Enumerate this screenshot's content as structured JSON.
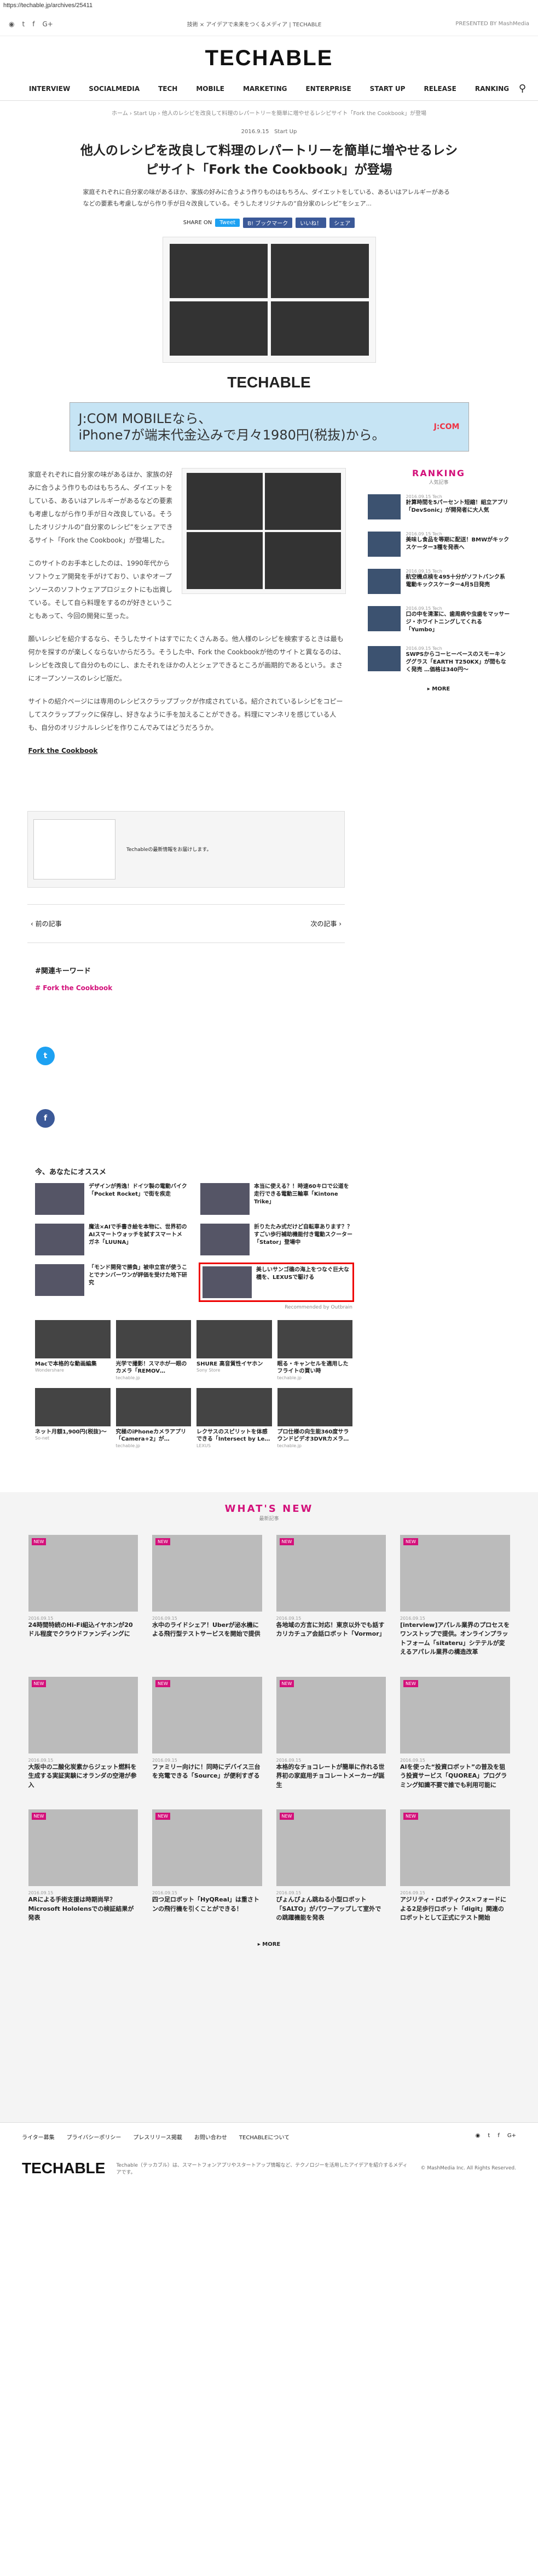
{
  "url": "https://techable.jp/archives/25411",
  "social": [
    "ׄ",
    "f",
    "G+"
  ],
  "topbar": {
    "center": "技術 × アイデアで未来をつくるメディア | TECHABLE",
    "right": "PRESENTED BY MashMedia"
  },
  "logo": "TECHABLE",
  "nav": [
    "INTERVIEW",
    "SOCIALMEDIA",
    "TECH",
    "MOBILE",
    "MARKETING",
    "ENTERPRISE",
    "START UP",
    "RELEASE",
    "RANKING"
  ],
  "breadcrumb": "ホーム › Start Up › 他人のレシピを改良して料理のレパートリーを簡単に増やせるレシピサイト「Fork the Cookbook」が登場",
  "meta": {
    "date": "2016.9.15",
    "category": "Start Up"
  },
  "headline": "他人のレシピを改良して料理のレパートリーを簡単に増やせるレシピサイト「Fork the Cookbook」が登場",
  "lead": "家庭それぞれに自分家の味があるほか、家族の好みに合うよう作りものはもちろん、ダイエットをしている、あるいはアレルギーがあるなどの要素も考慮しながら作り手が日々改良している。そうしたオリジナルの“自分家のレシピ”をシェア...",
  "share": {
    "label": "SHARE ON",
    "tweet": "Tweet",
    "b": "B! ブックマーク",
    "like": "いいね！",
    "pocket": "シェア"
  },
  "ad": {
    "text1": "J:COM MOBILEなら、",
    "text2": "iPhone7が端末代金込みで月々1980円(税抜)から。",
    "brand": "J:COM"
  },
  "article": [
    "家庭それぞれに自分家の味があるほか、家族の好みに合うよう作りものはもちろん、ダイエットをしている、あるいはアレルギーがあるなどの要素も考慮しながら作り手が日々改良している。そうしたオリジナルの“自分家のレシピ”をシェアできるサイト「Fork the Cookbook」が登場した。",
    "このサイトのお手本としたのは、1990年代からソフトウェア開発を手がけており、いまやオープンソースのソフトウェアプロジェクトにも出資している。そして自ら料理をするのが好きということもあって、今回の開発に至った。",
    "願いレシピを紹介するなら、そうしたサイトはすでにたくさんある。他人様のレシピを検索するときは最も何かを探すのが楽しくならないからだろう。そうした中、Fork the Cookbookが他のサイトと異なるのは、レシピを改良して自分のものにし、またそれをほかの人とシェアできるところが画期的であるという。まさにオープンソースのレシピ版だ。",
    "サイトの紹介ページには専用のレシピスクラップブックが作成されている。紹介されているレシピをコピーしてスクラップブックに保存し、好きなように手を加えることができる。料理にマンネリを感じている人も、自分のオリジナルレシピを作りこんでみてはどうだろうか。"
  ],
  "article_link": "Fork the Cookbook",
  "sidebar": {
    "title": "RANKING",
    "sub": "人気記事",
    "items": [
      {
        "date": "2016.09.15 Tech",
        "title": "計算時間を5パーセント短縮！組立アプリ「DevSonic」が開発者に大人気"
      },
      {
        "date": "2016.09.15 Tech",
        "title": "美味し食品を等期に配送！BMWがキックスケーター3種を発表へ"
      },
      {
        "date": "2016.09.15 Tech",
        "title": "航空機点検を495十分がソフトバンク系電動キックスケーター4月5日発売"
      },
      {
        "date": "2016.09.15 Tech",
        "title": "口の中を清潔に、歯周病や虫歯をマッサージ・ホワイトニングしてくれる「Yumbo」"
      },
      {
        "date": "2016.09.15 Tech",
        "title": "SWPSからコーヒーベースのスモーキンググラス「EARTH T250KX」が間もなく発売 …価格は340円～"
      }
    ],
    "more": "▸ MORE"
  },
  "embed_text": "Techableの最新情報をお届けします。",
  "pager": {
    "prev": "‹ 前の記事",
    "next": "次の記事 ›"
  },
  "related": {
    "heading": "#関連キーワード",
    "tag": "Fork the Cookbook"
  },
  "recommend": {
    "heading": "今、あなたにオススメ",
    "items": [
      "デザインが秀逸！ドイツ製の電動バイク「Pocket Rocket」で街を疾走",
      "本当に使える？！時速60キロで公道を走行できる電動三輪車「Kintone Trike」",
      "魔法×AIで手書き絵を本物に、世界初のAIスマートウォッチを試すスマートメガネ「LUUNA」",
      "折りたたみ式だけど自転車あります？？すごい歩行補助機能付き電動スクーター「Stator」登場中",
      "「モンド開発で勝負」被申立官が使うことでナンバーワンが評価を受けた地下研究",
      "美しいサンゴ礁の海上をつなぐ巨大な橋を、LEXUSで駆ける"
    ],
    "outbrain": "Recommended by Outbrain"
  },
  "ads": [
    {
      "title": "Macで本格的な動画編集",
      "src": "Wondershare"
    },
    {
      "title": "光学で撮影！スマホが一眼のカメラ「REMOV…",
      "src": "techable.jp"
    },
    {
      "title": "SHURE 高音質性イヤホン",
      "src": "Sony Store"
    },
    {
      "title": "眠る・キャンセルを適用したフライトの買い時",
      "src": "techable.jp"
    },
    {
      "title": "ネット月額1,900円(税抜)〜",
      "src": "So-net"
    },
    {
      "title": "究極のiPhoneカメラアプリ「Camera+2」が…",
      "src": "techable.jp"
    },
    {
      "title": "レクサスのスピリットを体感できる「Intersect by Le…",
      "src": "LEXUS"
    },
    {
      "title": "プロ仕様の向生能360度サラウンドビデオ3DVRカメラ…",
      "src": "techable.jp"
    }
  ],
  "whatsnew": {
    "title": "WHAT'S NEW",
    "sub": "最新記事",
    "items": [
      {
        "date": "2016.09.15",
        "title": "24時間特続のHi-Fi組込イヤホンが20ドル程度でクラウドファンディングに"
      },
      {
        "date": "2016.09.15",
        "title": "水中のライドシェア！Uberが泌水機による飛行型テストサービスを開始で提供"
      },
      {
        "date": "2016.09.15",
        "title": "各地域の方言に対応！東京以外でも話すカリカチュア会話ロボット「Vormor」"
      },
      {
        "date": "2016.09.15",
        "title": "[interview]アパレル業界のプロセスをワンストップで提供。オンラインプラットフォーム「sitateru」シテテルが変えるアパレル業界の構造改革"
      },
      {
        "date": "2016.09.15",
        "title": "大阪中の二酸化炭素からジェット燃料を生成する実証実験にオランダの空港が参入"
      },
      {
        "date": "2016.09.15",
        "title": "ファミリー向けに！同時にデバイス三台を充電できる「Source」が便利すぎる"
      },
      {
        "date": "2016.09.15",
        "title": "本格的なチョコレートが簡単に作れる世界初の家庭用チョコレートメーカーが誕生"
      },
      {
        "date": "2016.09.15",
        "title": "AIを使った“投資ロボット”の普及を狙う投資サービス「QUOREA」プログラミング知識不要で誰でも利用可能に"
      },
      {
        "date": "2016.09.15",
        "title": "ARによる手術支援は時期尚早？Microsoft Hololensでの検証結果が発表"
      },
      {
        "date": "2016.09.15",
        "title": "四つ足ロボット「HyQReal」は重さトンの飛行機を引くことができる！"
      },
      {
        "date": "2016.09.15",
        "title": "ぴょんぴょん跳ねる小型ロボット「SALTO」がパワーアップして室外での跳躍機能を発表"
      },
      {
        "date": "2016.09.15",
        "title": "アジリティ・ロボティクス×フォードによる2足歩行ロボット「digit」関連のロボットとして正式にテスト開始"
      }
    ],
    "more": "▸ MORE"
  },
  "footer": {
    "links": [
      "ライター募集",
      "プライバシーポリシー",
      "プレスリリース掲載",
      "お問い合わせ",
      "TECHABLEについて"
    ],
    "logo": "TECHABLE",
    "desc": "Techable（テッカブル）は、スマートフォンアプリやスタートアップ情報など、テクノロジーを活用したアイデアを紹介するメディアです。",
    "copy": "© MashMedia Inc. All Rights Reserved."
  }
}
